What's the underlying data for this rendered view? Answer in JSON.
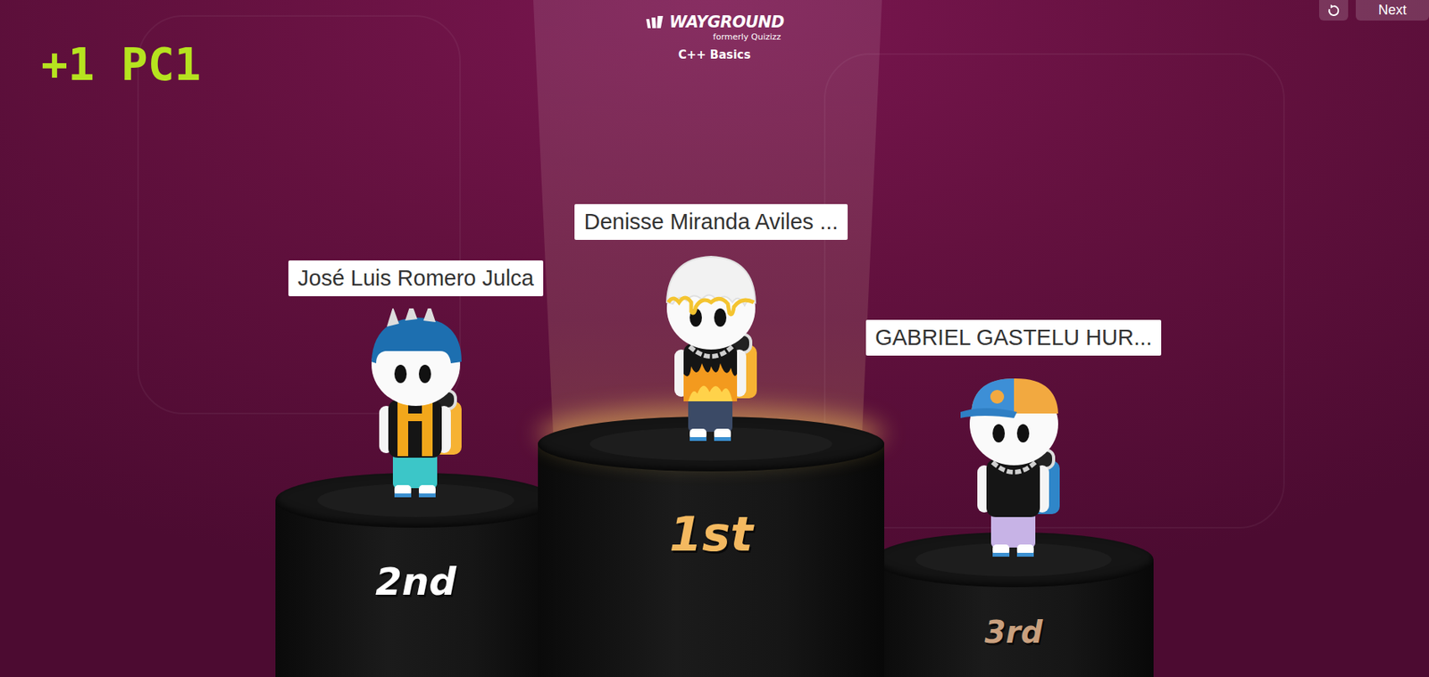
{
  "header": {
    "points_label": "+1 PC1"
  },
  "logo": {
    "brand": "WAYGROUND",
    "subtitle": "formerly Quizizz"
  },
  "quiz_title": "C++ Basics",
  "toolbar": {
    "next_label": "Next"
  },
  "podium": [
    {
      "place": "2nd",
      "name": "José Luis Romero Julca",
      "kind": "second",
      "color": "#ffffff"
    },
    {
      "place": "1st",
      "name": "Denisse Miranda Aviles ...",
      "kind": "first",
      "color": "#f4b960"
    },
    {
      "place": "3rd",
      "name": "GABRIEL GASTELU HUR...",
      "kind": "third",
      "color": "#c9a07e"
    }
  ]
}
